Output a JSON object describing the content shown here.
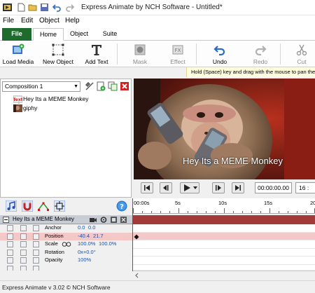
{
  "app": {
    "title": "Express Animate by NCH Software - Untitled*"
  },
  "menu": {
    "items": [
      "File",
      "Edit",
      "Object",
      "Help"
    ]
  },
  "tabs": {
    "file": "File",
    "home": "Home",
    "object": "Object",
    "suite": "Suite"
  },
  "ribbon": {
    "load_media": "Load Media",
    "new_object": "New Object",
    "add_text": "Add Text",
    "mask": "Mask",
    "effect": "Effect",
    "undo": "Undo",
    "redo": "Redo",
    "cut": "Cut"
  },
  "hint": "Hold (Space) key and drag with the mouse to pan the",
  "composition": {
    "selected": "Composition 1",
    "tree": [
      {
        "label": "Hey Its a MEME Monkey",
        "icon": "text-layer-icon"
      },
      {
        "label": "giphy",
        "icon": "image-layer-icon"
      }
    ]
  },
  "preview": {
    "caption": "Hey Its a MEME Monkey"
  },
  "player": {
    "timecode": "00:00:00.00",
    "fps": "16 :"
  },
  "ruler": {
    "labels": [
      "00:00s",
      "5s",
      "10s",
      "15s",
      "20"
    ]
  },
  "track": {
    "name": "Hey Its a MEME Monkey"
  },
  "properties": [
    {
      "name": "Anchor",
      "v1": "0.0",
      "v2": "0.0"
    },
    {
      "name": "Position",
      "v1": "-40.4",
      "v2": "21.7"
    },
    {
      "name": "Scale",
      "v1": "100.0%",
      "v2": "100.0%"
    },
    {
      "name": "Rotation",
      "v1": "0x+0.0°",
      "v2": ""
    },
    {
      "name": "Opacity",
      "v1": "100%",
      "v2": ""
    }
  ],
  "status": "Express Animate v 3.02 © NCH Software",
  "colors": {
    "file_tab": "#1e6b2e",
    "track_bar": "#a23a3a",
    "position_row": "#f5c8c8",
    "value_text": "#1a4fa8",
    "hint_bg": "#fffce0"
  }
}
